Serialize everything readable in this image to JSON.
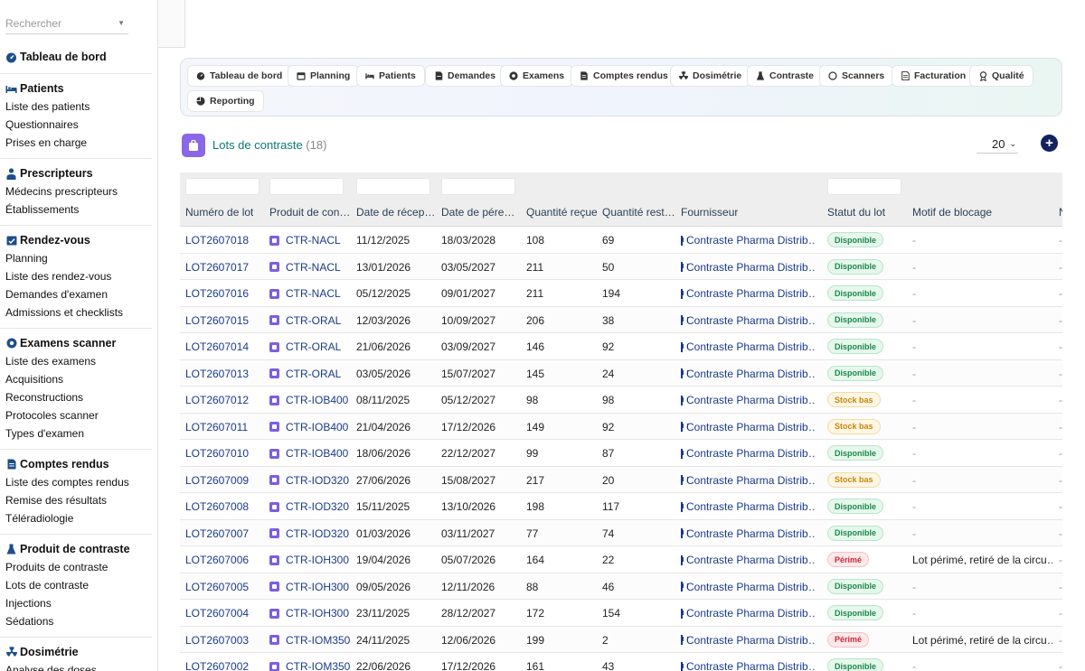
{
  "search": {
    "placeholder": "Rechercher"
  },
  "sidebar": {
    "dashboard": "Tableau de bord",
    "sections": [
      {
        "title": "Patients",
        "icon": "bed-icon",
        "items": [
          "Liste des patients",
          "Questionnaires",
          "Prises en charge"
        ]
      },
      {
        "title": "Prescripteurs",
        "icon": "doctor-icon",
        "items": [
          "Médecins prescripteurs",
          "Établissements"
        ]
      },
      {
        "title": "Rendez-vous",
        "icon": "calendar-check-icon",
        "items": [
          "Planning",
          "Liste des rendez-vous",
          "Demandes d'examen",
          "Admissions et checklists"
        ]
      },
      {
        "title": "Examens scanner",
        "icon": "scanner-icon",
        "items": [
          "Liste des examens",
          "Acquisitions",
          "Reconstructions",
          "Protocoles scanner",
          "Types d'examen"
        ]
      },
      {
        "title": "Comptes rendus",
        "icon": "report-icon",
        "items": [
          "Liste des comptes rendus",
          "Remise des résultats",
          "Téléradiologie"
        ]
      },
      {
        "title": "Produit de contraste",
        "icon": "flask-icon",
        "items": [
          "Produits de contraste",
          "Lots de contraste",
          "Injections",
          "Sédations"
        ]
      },
      {
        "title": "Dosimétrie",
        "icon": "radiation-icon",
        "items": [
          "Analyse des doses"
        ]
      }
    ]
  },
  "tabs": [
    {
      "label": "Tableau de bord",
      "icon": "gauge-icon"
    },
    {
      "label": "Planning",
      "icon": "calendar-icon"
    },
    {
      "label": "Patients",
      "icon": "bed-icon"
    },
    {
      "label": "Demandes",
      "icon": "document-icon"
    },
    {
      "label": "Examens",
      "icon": "scanner-icon"
    },
    {
      "label": "Comptes rendus",
      "icon": "report-icon"
    },
    {
      "label": "Dosimétrie",
      "icon": "radiation-icon"
    },
    {
      "label": "Contraste",
      "icon": "flask-icon"
    },
    {
      "label": "Scanners",
      "icon": "circle-icon"
    },
    {
      "label": "Facturation",
      "icon": "invoice-icon"
    },
    {
      "label": "Qualité",
      "icon": "award-icon"
    },
    {
      "label": "Reporting",
      "icon": "chart-icon"
    }
  ],
  "list": {
    "title": "Lots de contraste",
    "count": "(18)",
    "page_size": "20"
  },
  "table": {
    "columns": [
      "Numéro de lot",
      "Produit de con…",
      "Date de récep…",
      "Date de pére…",
      "Quantité reçue",
      "Quantité rest…",
      "Fournisseur",
      "Statut du lot",
      "Motif de blocage",
      "N"
    ],
    "rows": [
      {
        "lot": "LOT2607018",
        "produit": "CTR-NACL",
        "reception": "11/12/2025",
        "peremption": "18/03/2028",
        "recue": "108",
        "restante": "69",
        "fournisseur": "Contraste Pharma Distrib…",
        "statut": "Disponible",
        "statut_type": "ok",
        "motif": "-",
        "n": "-"
      },
      {
        "lot": "LOT2607017",
        "produit": "CTR-NACL",
        "reception": "13/01/2026",
        "peremption": "03/05/2027",
        "recue": "211",
        "restante": "50",
        "fournisseur": "Contraste Pharma Distrib…",
        "statut": "Disponible",
        "statut_type": "ok",
        "motif": "-",
        "n": "-"
      },
      {
        "lot": "LOT2607016",
        "produit": "CTR-NACL",
        "reception": "05/12/2025",
        "peremption": "09/01/2027",
        "recue": "211",
        "restante": "194",
        "fournisseur": "Contraste Pharma Distrib…",
        "statut": "Disponible",
        "statut_type": "ok",
        "motif": "-",
        "n": "-"
      },
      {
        "lot": "LOT2607015",
        "produit": "CTR-ORAL",
        "reception": "12/03/2026",
        "peremption": "10/09/2027",
        "recue": "206",
        "restante": "38",
        "fournisseur": "Contraste Pharma Distrib…",
        "statut": "Disponible",
        "statut_type": "ok",
        "motif": "-",
        "n": "-"
      },
      {
        "lot": "LOT2607014",
        "produit": "CTR-ORAL",
        "reception": "21/06/2026",
        "peremption": "03/09/2027",
        "recue": "146",
        "restante": "92",
        "fournisseur": "Contraste Pharma Distrib…",
        "statut": "Disponible",
        "statut_type": "ok",
        "motif": "-",
        "n": "-"
      },
      {
        "lot": "LOT2607013",
        "produit": "CTR-ORAL",
        "reception": "03/05/2026",
        "peremption": "15/07/2027",
        "recue": "145",
        "restante": "24",
        "fournisseur": "Contraste Pharma Distrib…",
        "statut": "Disponible",
        "statut_type": "ok",
        "motif": "-",
        "n": "-"
      },
      {
        "lot": "LOT2607012",
        "produit": "CTR-IOB400",
        "reception": "08/11/2025",
        "peremption": "05/12/2027",
        "recue": "98",
        "restante": "98",
        "fournisseur": "Contraste Pharma Distrib…",
        "statut": "Stock bas",
        "statut_type": "low",
        "motif": "-",
        "n": "-"
      },
      {
        "lot": "LOT2607011",
        "produit": "CTR-IOB400",
        "reception": "21/04/2026",
        "peremption": "17/12/2026",
        "recue": "149",
        "restante": "92",
        "fournisseur": "Contraste Pharma Distrib…",
        "statut": "Stock bas",
        "statut_type": "low",
        "motif": "-",
        "n": "-"
      },
      {
        "lot": "LOT2607010",
        "produit": "CTR-IOB400",
        "reception": "18/06/2026",
        "peremption": "22/12/2027",
        "recue": "99",
        "restante": "87",
        "fournisseur": "Contraste Pharma Distrib…",
        "statut": "Disponible",
        "statut_type": "ok",
        "motif": "-",
        "n": "-"
      },
      {
        "lot": "LOT2607009",
        "produit": "CTR-IOD320",
        "reception": "27/06/2026",
        "peremption": "15/08/2027",
        "recue": "217",
        "restante": "20",
        "fournisseur": "Contraste Pharma Distrib…",
        "statut": "Stock bas",
        "statut_type": "low",
        "motif": "-",
        "n": "-"
      },
      {
        "lot": "LOT2607008",
        "produit": "CTR-IOD320",
        "reception": "15/11/2025",
        "peremption": "13/10/2026",
        "recue": "198",
        "restante": "117",
        "fournisseur": "Contraste Pharma Distrib…",
        "statut": "Disponible",
        "statut_type": "ok",
        "motif": "-",
        "n": "-"
      },
      {
        "lot": "LOT2607007",
        "produit": "CTR-IOD320",
        "reception": "01/03/2026",
        "peremption": "03/11/2027",
        "recue": "77",
        "restante": "74",
        "fournisseur": "Contraste Pharma Distrib…",
        "statut": "Disponible",
        "statut_type": "ok",
        "motif": "-",
        "n": "-"
      },
      {
        "lot": "LOT2607006",
        "produit": "CTR-IOH300",
        "reception": "19/04/2026",
        "peremption": "05/07/2026",
        "recue": "164",
        "restante": "22",
        "fournisseur": "Contraste Pharma Distrib…",
        "statut": "Périmé",
        "statut_type": "exp",
        "motif": "Lot périmé, retiré de la circu…",
        "n": "-"
      },
      {
        "lot": "LOT2607005",
        "produit": "CTR-IOH300",
        "reception": "09/05/2026",
        "peremption": "12/11/2026",
        "recue": "88",
        "restante": "46",
        "fournisseur": "Contraste Pharma Distrib…",
        "statut": "Disponible",
        "statut_type": "ok",
        "motif": "-",
        "n": "-"
      },
      {
        "lot": "LOT2607004",
        "produit": "CTR-IOH300",
        "reception": "23/11/2025",
        "peremption": "28/12/2027",
        "recue": "172",
        "restante": "154",
        "fournisseur": "Contraste Pharma Distrib…",
        "statut": "Disponible",
        "statut_type": "ok",
        "motif": "-",
        "n": "-"
      },
      {
        "lot": "LOT2607003",
        "produit": "CTR-IOM350",
        "reception": "24/11/2025",
        "peremption": "12/06/2026",
        "recue": "199",
        "restante": "2",
        "fournisseur": "Contraste Pharma Distrib…",
        "statut": "Périmé",
        "statut_type": "exp",
        "motif": "Lot périmé, retiré de la circu…",
        "n": "-"
      },
      {
        "lot": "LOT2607002",
        "produit": "CTR-IOM350",
        "reception": "22/06/2026",
        "peremption": "17/12/2026",
        "recue": "161",
        "restante": "43",
        "fournisseur": "Contraste Pharma Distrib…",
        "statut": "Disponible",
        "statut_type": "ok",
        "motif": "-",
        "n": "-"
      }
    ]
  },
  "colors": {
    "accent": "#14215f",
    "link": "#1a3a8c",
    "title": "#0c7a7a",
    "product_icon": "#7b5fe0"
  }
}
